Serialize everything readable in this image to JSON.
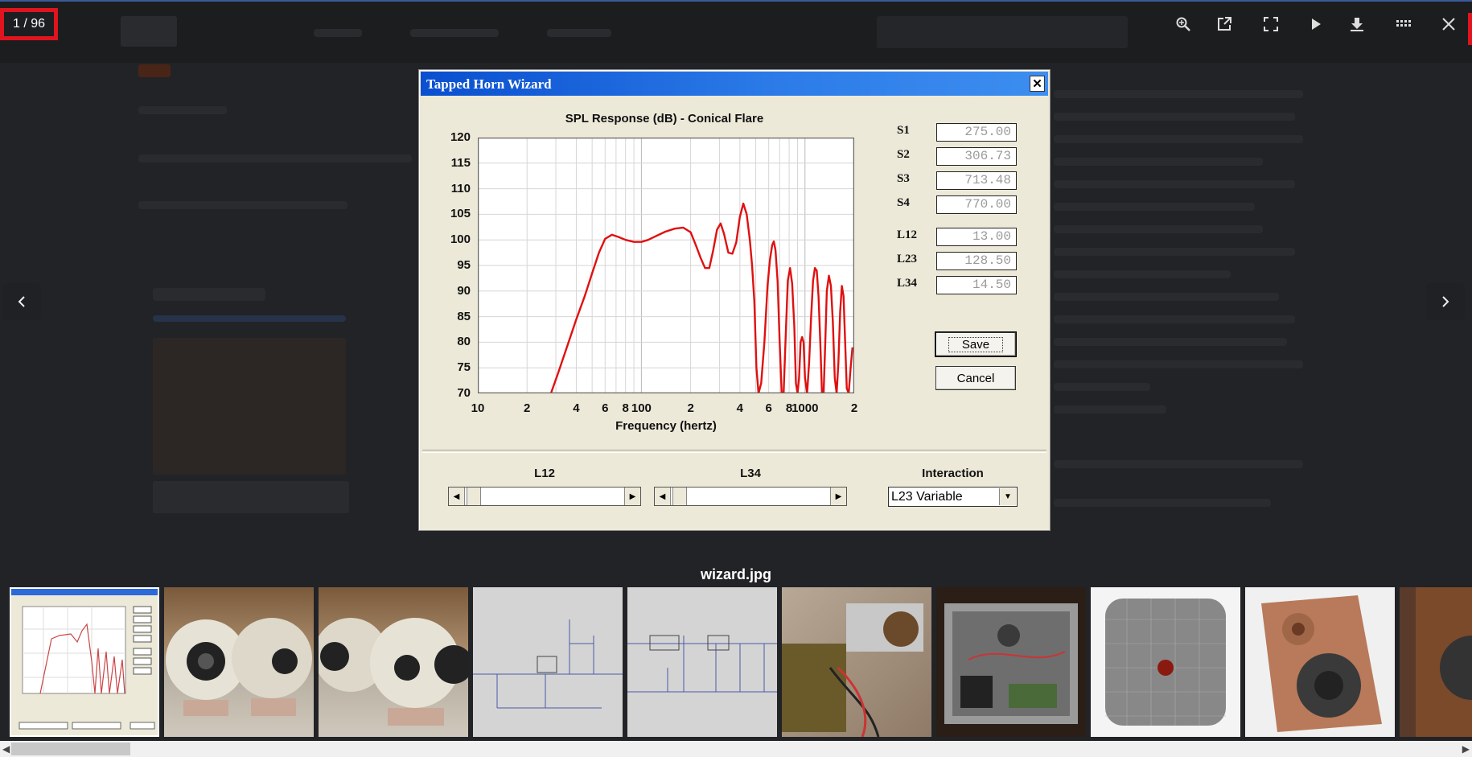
{
  "viewer": {
    "counter": "1 / 96",
    "filename": "wizard.jpg",
    "toolbar": [
      "zoom-in",
      "open-in-new-window",
      "fullscreen",
      "play-slideshow",
      "download",
      "thumbnails",
      "close"
    ]
  },
  "dialog": {
    "title": "Tapped Horn Wizard",
    "close_label": "✕",
    "params": [
      {
        "label": "S1",
        "value": "275.00"
      },
      {
        "label": "S2",
        "value": "306.73"
      },
      {
        "label": "S3",
        "value": "713.48"
      },
      {
        "label": "S4",
        "value": "770.00"
      },
      {
        "label": "L12",
        "value": "13.00"
      },
      {
        "label": "L23",
        "value": "128.50"
      },
      {
        "label": "L34",
        "value": "14.50"
      }
    ],
    "save_label": "Save",
    "cancel_label": "Cancel",
    "slider_l12_label": "L12",
    "slider_l34_label": "L34",
    "interaction_label": "Interaction",
    "interaction_value": "L23 Variable"
  },
  "chart_data": {
    "type": "line",
    "title": "SPL Response (dB) - Conical Flare",
    "xlabel": "Frequency (hertz)",
    "ylabel": "",
    "xscale": "log",
    "xlim": [
      10,
      2000
    ],
    "ylim": [
      70,
      120
    ],
    "yticks": [
      "120",
      "115",
      "110",
      "105",
      "100",
      "95",
      "90",
      "85",
      "80",
      "75",
      "70"
    ],
    "xticks": [
      {
        "label": "10",
        "v": 10
      },
      {
        "label": "2",
        "v": 20
      },
      {
        "label": "4",
        "v": 40
      },
      {
        "label": "6",
        "v": 60
      },
      {
        "label": "8",
        "v": 80
      },
      {
        "label": "100",
        "v": 100
      },
      {
        "label": "2",
        "v": 200
      },
      {
        "label": "4",
        "v": 400
      },
      {
        "label": "6",
        "v": 600
      },
      {
        "label": "8",
        "v": 800
      },
      {
        "label": "1000",
        "v": 1000
      },
      {
        "label": "2",
        "v": 2000
      }
    ],
    "grid": true,
    "color": "#e01010",
    "series": [
      {
        "x": [
          28,
          31,
          35,
          40,
          45,
          50,
          55,
          60,
          66,
          72,
          80,
          90,
          100,
          110,
          120,
          140,
          160,
          180,
          200,
          215,
          230,
          245,
          260,
          275,
          290,
          305,
          320,
          340,
          360,
          380,
          400,
          420,
          440,
          460,
          475,
          490,
          505,
          520,
          540,
          565,
          590,
          610,
          630,
          645,
          660,
          680,
          700,
          720,
          740,
          760,
          785,
          810,
          835,
          860,
          880,
          900,
          920,
          940,
          960,
          980,
          1000,
          1030,
          1060,
          1090,
          1120,
          1150,
          1180,
          1210,
          1240,
          1270,
          1300,
          1330,
          1360,
          1400,
          1440,
          1480,
          1520,
          1560,
          1600,
          1640,
          1680,
          1720,
          1760,
          1800,
          1850,
          1900,
          1950
        ],
        "y": [
          70,
          74,
          79,
          84.5,
          89,
          93.5,
          97.5,
          100.2,
          101,
          100.6,
          100,
          99.6,
          99.6,
          100,
          100.6,
          101.6,
          102.2,
          102.4,
          101.5,
          99,
          96.5,
          94.5,
          94.5,
          98,
          102,
          103.2,
          101.2,
          97.5,
          97.3,
          99.5,
          104.5,
          107.1,
          105,
          100,
          95,
          88,
          75,
          70,
          72,
          80,
          91,
          96,
          99,
          99.7,
          98,
          92,
          80,
          70,
          70,
          80,
          92,
          94.5,
          91.5,
          83,
          72,
          70,
          73,
          80,
          81,
          80,
          73,
          70,
          76,
          85,
          92,
          94.5,
          94,
          89,
          80,
          70,
          70,
          80,
          90,
          93,
          91,
          84,
          73,
          70,
          76,
          86,
          91,
          89,
          80,
          71,
          70,
          75,
          79
        ]
      }
    ]
  }
}
